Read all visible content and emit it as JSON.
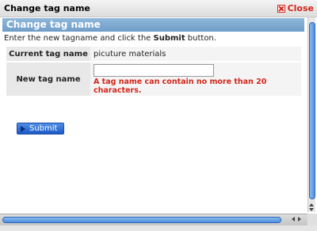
{
  "window": {
    "title": "Change tag name",
    "close_label": "Close"
  },
  "section": {
    "header": "Change tag name",
    "instructions_before": "Enter the new tagname and click the ",
    "instructions_bold": "Submit",
    "instructions_after": " button."
  },
  "form": {
    "current_label": "Current tag name",
    "current_value": "picuture materials",
    "new_label": "New tag name",
    "new_value": "",
    "error": "A tag name can contain no more than 20 characters."
  },
  "actions": {
    "submit_label": "Submit"
  },
  "icons": {
    "close": "close-icon",
    "submit": "play-icon"
  },
  "colors": {
    "header_bg": "#7aa6d0",
    "error": "#d2261b",
    "button": "#2f6fd8"
  }
}
